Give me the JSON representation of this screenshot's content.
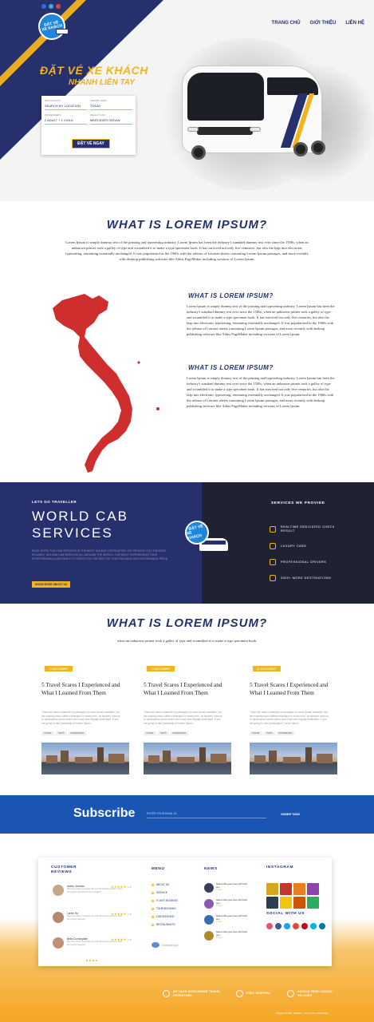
{
  "hero": {
    "logo_text_1": "ĐẶT VÉ",
    "logo_text_2": "XE KHÁCH",
    "nav": [
      "TRANG CHỦ",
      "GIỚI THIỆU",
      "LIÊN HỆ"
    ],
    "title": "ĐẶT VÉ XE KHÁCH",
    "subtitle": "NHANH LIỀN TAY",
    "form": {
      "destination_label": "DESTINATION",
      "destination_value": "SEARCH MY LOCATION",
      "depart_label": "DEPART DATE",
      "depart_value": "TODAY",
      "passengers_label": "PASSENGERS",
      "passengers_value": "2 ADULT + 1 CHILD",
      "class_label": "SELECT CAB",
      "class_value": "MERCEDES SEDAN",
      "button": "ĐẶT VÉ NGAY"
    }
  },
  "intro": {
    "heading": "WHAT IS LOREM IPSUM?",
    "text": "Lorem Ipsum is simply dummy text of the printing and typesetting industry. Lorem Ipsum has been the industry's standard dummy text ever since the 1500s, when an unknown printer took a galley of type and scrambled it to make a type specimen book. It has survived not only five centuries, but also the leap into electronic typesetting, remaining essentially unchanged. It was popularised in the 1960s with the release of Letraset sheets containing Lorem Ipsum passages, and more recently with desktop publishing software like Aldus PageMaker including versions of Lorem Ipsum."
  },
  "about": {
    "block1_heading": "WHAT IS LOREM IPSUM?",
    "block1_text": "Lorem Ipsum is simply dummy text of the printing and typesetting industry. Lorem Ipsum has been the industry's standard dummy text ever since the 1500s, when an unknown printer took a galley of type and scrambled it to make a type specimen book. It has survived not only five centuries, but also the leap into electronic typesetting, remaining essentially unchanged. It was popularised in the 1960s with the release of Letraset sheets containing Lorem Ipsum passages, and more recently with desktop publishing software like Aldus PageMaker including versions of Lorem Ipsum.",
    "block2_heading": "WHAT IS LOREM IPSUM?",
    "block2_text": "Lorem Ipsum is simply dummy text of the printing and typesetting industry. Lorem Ipsum has been the industry's standard dummy text ever since the 1500s, when an unknown printer took a galley of type and scrambled it to make a type specimen book. It has survived not only five centuries, but also the leap into electronic typesetting, remaining essentially unchanged. It was popularised in the 1960s with the release of Letraset sheets containing Lorem Ipsum passages, and more recently with desktop publishing software like Aldus PageMaker including versions of Lorem Ipsum."
  },
  "cab": {
    "kicker": "LETS GO TRAVELLER",
    "title_1": "WORLD CAB",
    "title_2": "SERVICES",
    "desc": "BOOK HOTEL TAXI CAB SERVICES IN THE MOST HOLIDAY DESTINATION. LET PROVIDE YOU THE MOST RELIABLE TAXI AND CAB SERVICES ALL AROUND THE WORLD. OUR MOST EXPERIENCED TOUR PROFESSIONALS ARE READY TO SERVE YOU THE BEST OF YOUR PACKAGE WITH AFFORDABLE PRICE.",
    "button": "KNOW MORE ABOUT US",
    "badge_1": "ĐẶT VÉ",
    "badge_2": "XE KHÁCH",
    "services_heading": "SERVICES WE PROVIDE",
    "services": [
      {
        "icon": "location-pin-icon",
        "label": "REALTIME DEDICATED CHECK RESULT"
      },
      {
        "icon": "car-icon",
        "label": "LUXURY CABS"
      },
      {
        "icon": "driver-icon",
        "label": "PROFESSIONAL DRIVERS"
      },
      {
        "icon": "globe-icon",
        "label": "3000+ MORE DESTINATIONS"
      }
    ]
  },
  "blog": {
    "heading": "WHAT IS LOREM IPSUM?",
    "subtitle": "when an unknown printer took a galley of type and scrambled it to make a type specimen book.",
    "posts": [
      {
        "date": "21 DECEMBER",
        "title": "5 Travel Scares I Experienced and What I Learned From Them",
        "desc": "There are many variations of passages of Lorem Ipsum available, but the majority have suffered alteration in some form, by injected humour, or randomised words which don't look even slightly believable. If you are going to use a passage of Lorem Ipsum.",
        "tags": [
          "TRAVEL",
          "TRIPS",
          "EXPERIENCE"
        ]
      },
      {
        "date": "21 DECEMBER",
        "title": "5 Travel Scares I Experienced and What I Learned From Them",
        "desc": "There are many variations of passages of Lorem Ipsum available, but the majority have suffered alteration in some form, by injected humour, or randomised words which don't look even slightly believable. If you are going to use a passage of Lorem Ipsum.",
        "tags": [
          "TRAVEL",
          "TRIPS",
          "EXPERIENCE"
        ]
      },
      {
        "date": "21 DECEMBER",
        "title": "5 Travel Scares I Experienced and What I Learned From Them",
        "desc": "There are many variations of passages of Lorem Ipsum available, but the majority have suffered alteration in some form, by injected humour, or randomised words which don't look even slightly believable. If you are going to use a passage of Lorem Ipsum.",
        "tags": [
          "TRAVEL",
          "TRIPS",
          "EXPERIENCE"
        ]
      }
    ]
  },
  "subscribe": {
    "title": "Subscribe",
    "placeholder": "ENTER YOUR EMAIL ID",
    "button": "SUBMIT NOW"
  },
  "footer": {
    "reviews_heading_1": "CUSTOMER",
    "reviews_heading_2": "REVIEWS",
    "reviews": [
      {
        "name": "Alvaro Johnson",
        "stars": "★★★★★",
        "score": "4.8",
        "text": "We have written examples for over 80 industry sectors. Find the perfect example for your situation."
      },
      {
        "name": "Lorem Ha",
        "stars": "★★★★★",
        "score": "4.8",
        "text": "We have written examples for over 80 industry sectors. Find the perfect example."
      },
      {
        "name": "Bella Cunningham",
        "stars": "★★★★★",
        "score": "4.8",
        "text": "We have written examples for over 80 industry sectors. Find the perfect example."
      }
    ],
    "menu_heading": "MENU",
    "menu": [
      "ABOUT US",
      "SERVICE",
      "FLIGHT BOOKING",
      "TOUR BOOKING",
      "CAB BOOKING",
      "RESTAURANTS"
    ],
    "menu_note": "Download App",
    "news_heading": "NEWS",
    "news": [
      {
        "text": "Nature title goes here with bold text",
        "date": "5 days"
      },
      {
        "text": "Nature title goes here with bold text",
        "date": "5 days"
      },
      {
        "text": "Nature title goes here with bold text",
        "date": "5 days"
      },
      {
        "text": "Nature title goes here with bold text",
        "date": "5 days"
      }
    ],
    "instagram_heading": "INSTAGRAM",
    "social_heading": "SOCIAL WITH US",
    "features": [
      {
        "icon": "globe-icon",
        "label": "WE HAVE WORLDWIDE TRAVEL OPERATORS"
      },
      {
        "icon": "shipping-icon",
        "label": "FREE SHIPPING"
      },
      {
        "icon": "cancel-icon",
        "label": "HASSLE FREE CANCEL POLICIES"
      }
    ],
    "copyright": "TERMS OF USE · PRIVACY · ALL RIGHTS RESERVED"
  }
}
